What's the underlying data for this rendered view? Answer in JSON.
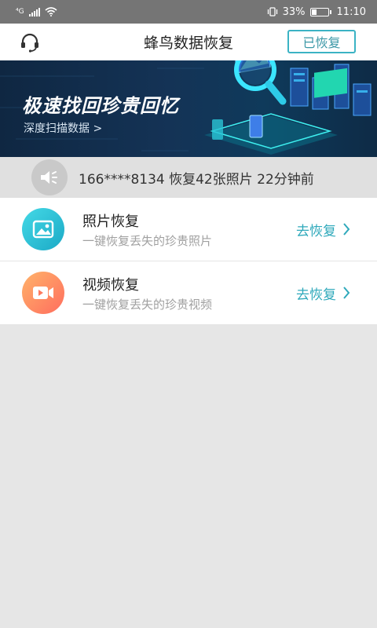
{
  "status_bar": {
    "carrier": "⁴G",
    "battery_percent": "33%",
    "battery_level": 0.33,
    "time": "11:10"
  },
  "header": {
    "title": "蜂鸟数据恢复",
    "restored_label": "已恢复"
  },
  "banner": {
    "title": "极速找回珍贵回忆",
    "subtitle": "深度扫描数据 >"
  },
  "notice": {
    "text": "166****8134 恢复42张照片 22分钟前"
  },
  "items": [
    {
      "title": "照片恢复",
      "desc": "一键恢复丢失的珍贵照片",
      "action": "去恢复",
      "icon": "photo-icon"
    },
    {
      "title": "视频恢复",
      "desc": "一键恢复丢失的珍贵视频",
      "action": "去恢复",
      "icon": "video-icon"
    }
  ],
  "colors": {
    "accent": "#2fa9bb",
    "status_bar": "#757575",
    "banner_bg": "#143356",
    "photo_icon": "#1ba9c6",
    "video_icon": "#ff6d5e"
  }
}
